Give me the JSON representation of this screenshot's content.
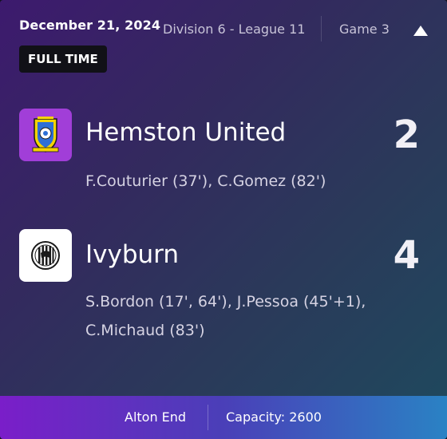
{
  "match": {
    "date": "December 21, 2024",
    "division": "Division 6 - League 11",
    "game": "Game 3",
    "status": "FULL TIME"
  },
  "home": {
    "name": "Hemston United",
    "score": "2",
    "scorers": [
      "F.Couturier (37'), C.Gomez (82')"
    ],
    "badge_color": "#a13ed8"
  },
  "away": {
    "name": "Ivyburn",
    "score": "4",
    "scorers": [
      "S.Bordon (17', 64'), J.Pessoa (45'+1),",
      "C.Michaud (83')"
    ],
    "badge_color": "#ffffff"
  },
  "footer": {
    "venue": "Alton End",
    "capacity": "Capacity: 2600"
  },
  "icons": {
    "collapse": "chevron-up-icon",
    "home_badge": "hemston-united-crest-icon",
    "away_badge": "ivyburn-crest-icon"
  }
}
